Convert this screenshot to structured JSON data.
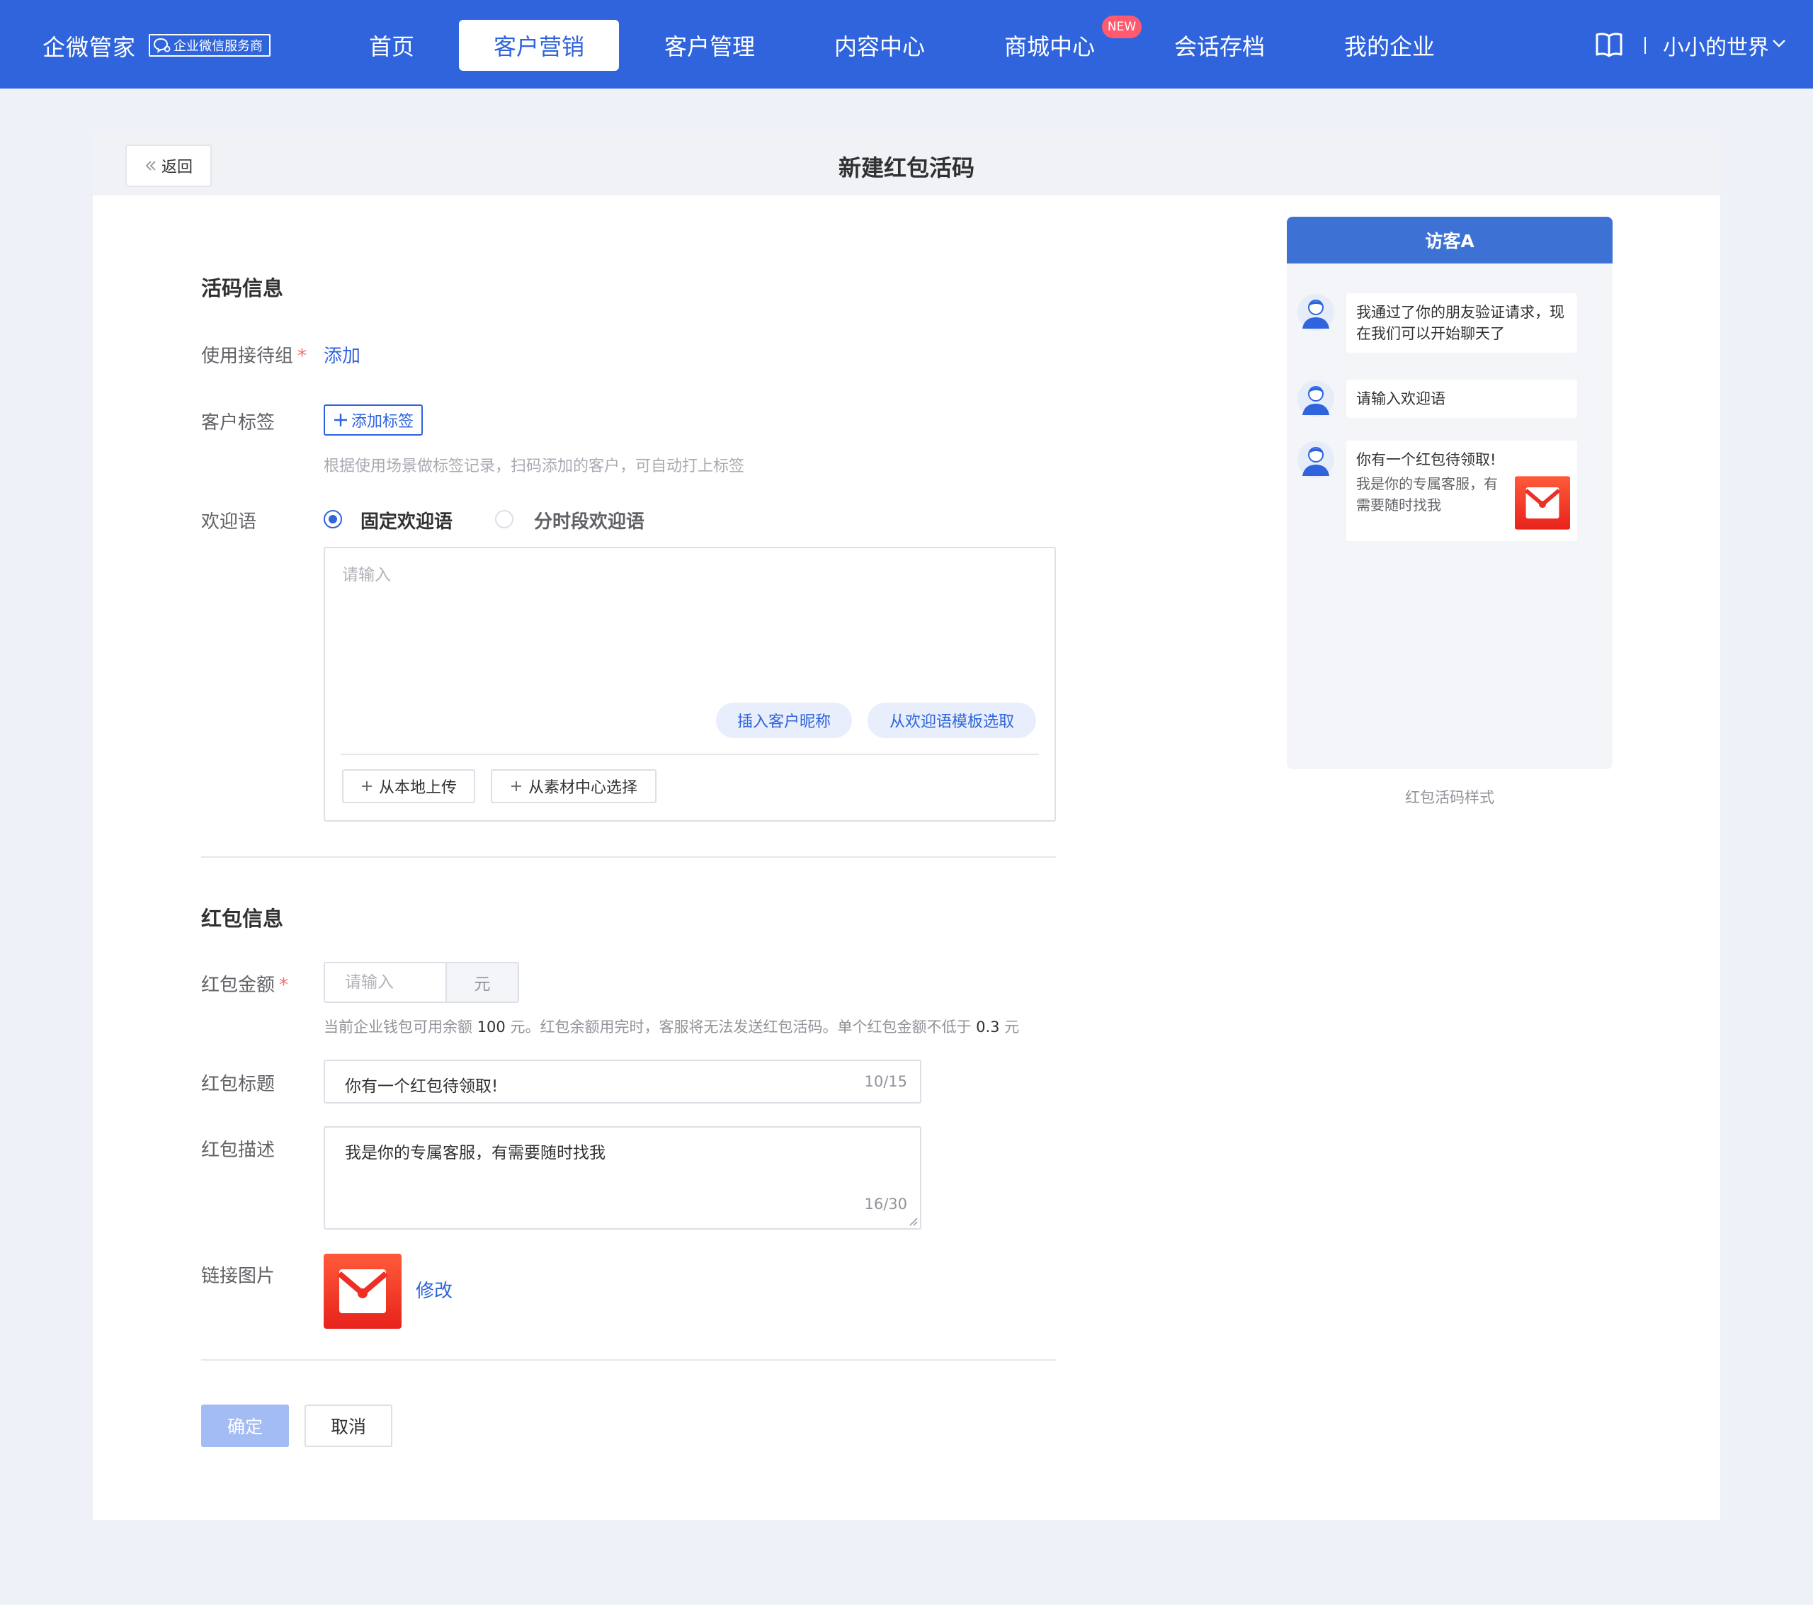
{
  "brand": {
    "name": "企微管家",
    "badge": "企业微信服务商"
  },
  "nav": {
    "items": [
      {
        "label": "首页"
      },
      {
        "label": "客户营销",
        "active": true
      },
      {
        "label": "客户管理"
      },
      {
        "label": "内容中心"
      },
      {
        "label": "商城中心",
        "badge": "NEW"
      },
      {
        "label": "会话存档"
      },
      {
        "label": "我的企业"
      }
    ],
    "user": "小小的世界"
  },
  "page": {
    "back": "返回",
    "title": "新建红包活码"
  },
  "code_info": {
    "section_title": "活码信息",
    "group_label": "使用接待组",
    "group_action": "添加",
    "tag_label": "客户标签",
    "tag_button": "添加标签",
    "tag_hint": "根据使用场景做标签记录，扫码添加的客户，可自动打上标签",
    "welcome_label": "欢迎语",
    "welcome_options": [
      "固定欢迎语",
      "分时段欢迎语"
    ],
    "welcome_selected": "固定欢迎语",
    "welcome_placeholder": "请输入",
    "insert_nickname": "插入客户昵称",
    "pick_template": "从欢迎语模板选取",
    "upload_local": "从本地上传",
    "upload_library": "从素材中心选择"
  },
  "redpacket_info": {
    "section_title": "红包信息",
    "amount_label": "红包金额",
    "amount_placeholder": "请输入",
    "amount_unit": "元",
    "balance_prefix": "当前企业钱包可用余额 ",
    "balance_value": "100",
    "balance_middle": " 元。红包余额用完时，客服将无法发送红包活码。单个红包金额不低于 ",
    "min_value": "0.3",
    "balance_suffix": " 元",
    "title_label": "红包标题",
    "title_value": "你有一个红包待领取!",
    "title_count": "10/15",
    "desc_label": "红包描述",
    "desc_value": "我是你的专属客服，有需要随时找我",
    "desc_count": "16/30",
    "image_label": "链接图片",
    "image_action": "修改"
  },
  "actions": {
    "confirm": "确定",
    "cancel": "取消"
  },
  "preview": {
    "header": "访客A",
    "messages": [
      {
        "text": "我通过了你的朋友验证请求，现在我们可以开始聊天了"
      },
      {
        "text": "请输入欢迎语"
      },
      {
        "title": "你有一个红包待领取!",
        "desc": "我是你的专属客服，有需要随时找我"
      }
    ],
    "caption": "红包活码样式"
  },
  "colors": {
    "primary": "#2f64dc",
    "redpacket": "#f03a2e",
    "required": "#f56c6c"
  }
}
